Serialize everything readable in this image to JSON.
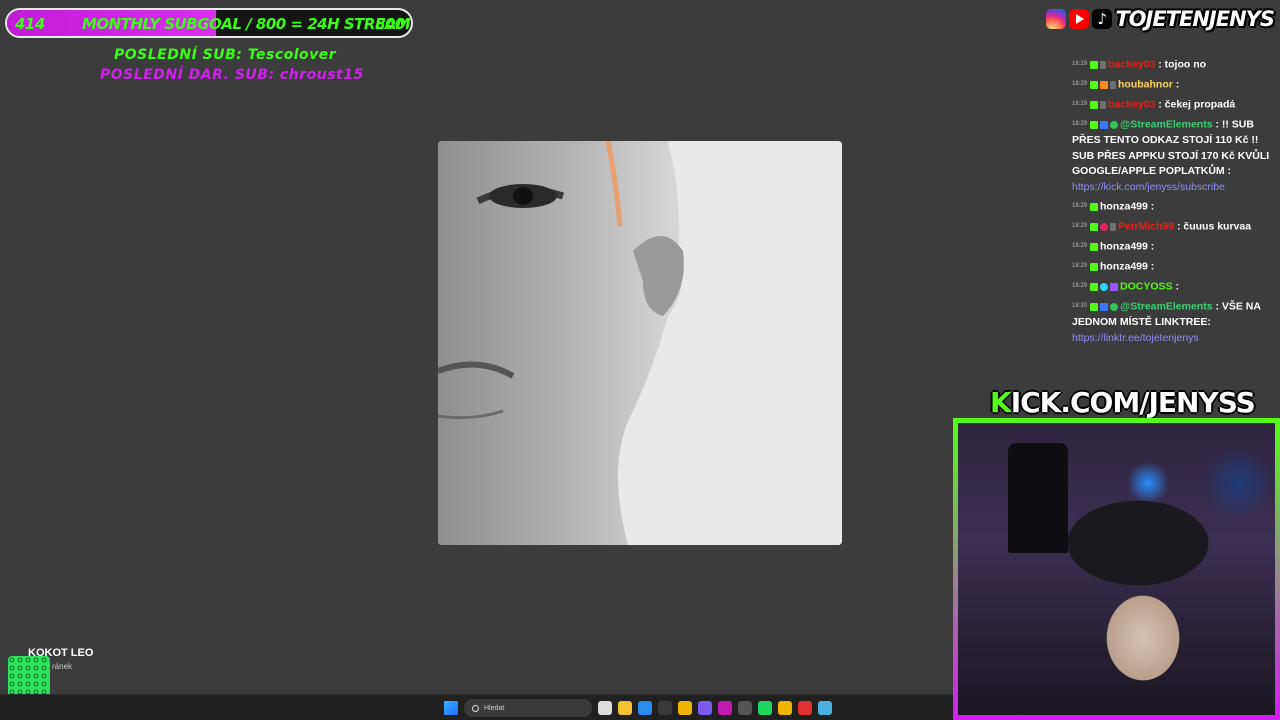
{
  "overlay": {
    "subgoal": {
      "current": "414",
      "label": "MONTHLY SUBGOAL / 800 = 24H STREAM",
      "target": "800",
      "progress_fraction": 0.5175,
      "fill_color": "#c21bd8",
      "text_color": "#39ff14"
    },
    "last_sub": "POSLEDNÍ SUB: Tescolover",
    "last_donation": "POSLEDNÍ DAR. SUB: chroust15",
    "socials": {
      "icons": [
        "instagram-icon",
        "youtube-icon",
        "tiktok-icon"
      ],
      "handle": "TOJETENJENYS"
    },
    "kick_url": {
      "k": "K",
      "rest": "ICK.COM/JENYSS",
      "accent": "#53fc18"
    }
  },
  "chat": {
    "messages": [
      {
        "time": "18:29",
        "user": "backey03",
        "user_color": "#e2231a",
        "text": ": tojoo no",
        "badges": [
          "k",
          "m"
        ]
      },
      {
        "time": "18:29",
        "user": "houbahnor",
        "user_color": "#ffd65c",
        "text": ":",
        "badges": [
          "k",
          "o",
          "m"
        ]
      },
      {
        "time": "18:29",
        "user": "backey03",
        "user_color": "#e2231a",
        "text": ": čekej propadá",
        "badges": [
          "k",
          "m"
        ]
      },
      {
        "time": "18:29",
        "user": "@StreamElements",
        "user_color": "#3cd070",
        "text": ": !! SUB PŘES TENTO ODKAZ STOJÍ 110 Kč !! SUB PŘES APPKU STOJÍ 170 Kč KVŮLI GOOGLE/APPLE POPLATKŮM :",
        "link": "https://kick.com/jenyss/subscribe",
        "badges": [
          "k",
          "b",
          "g"
        ]
      },
      {
        "time": "18:29",
        "user": "honza499",
        "user_color": "#ffffff",
        "text": ":",
        "badges": [
          "k"
        ]
      },
      {
        "time": "18:29",
        "user": "PetrMich99",
        "user_color": "#e2231a",
        "text": ": čuuus kurvaa",
        "badges": [
          "k",
          "p",
          "m"
        ]
      },
      {
        "time": "18:29",
        "user": "honza499",
        "user_color": "#ffffff",
        "text": ":",
        "badges": [
          "k"
        ]
      },
      {
        "time": "18:29",
        "user": "honza499",
        "user_color": "#ffffff",
        "text": ":",
        "badges": [
          "k"
        ]
      },
      {
        "time": "18:29",
        "user": "DOCYOSS",
        "user_color": "#53fc18",
        "text": ":",
        "badges": [
          "k",
          "c",
          "v"
        ]
      },
      {
        "time": "18:30",
        "user": "@StreamElements",
        "user_color": "#3cd070",
        "text": ": VŠE NA JEDNOM MÍSTĚ LINKTREE:",
        "link": "https://linktr.ee/tojetenjenys",
        "badges": [
          "k",
          "b",
          "g"
        ]
      }
    ]
  },
  "now_playing": {
    "title": "KOKOT LEO",
    "subtitle": "ránek"
  },
  "taskbar": {
    "search_placeholder": "Hledat",
    "apps": [
      "file-manager-icon",
      "folder-icon",
      "edge-icon",
      "store-icon",
      "chrome-icon",
      "discord-icon",
      "obs-icon",
      "terminal-icon",
      "spotify-icon",
      "chrome-icon",
      "record-icon",
      "notes-icon"
    ]
  }
}
